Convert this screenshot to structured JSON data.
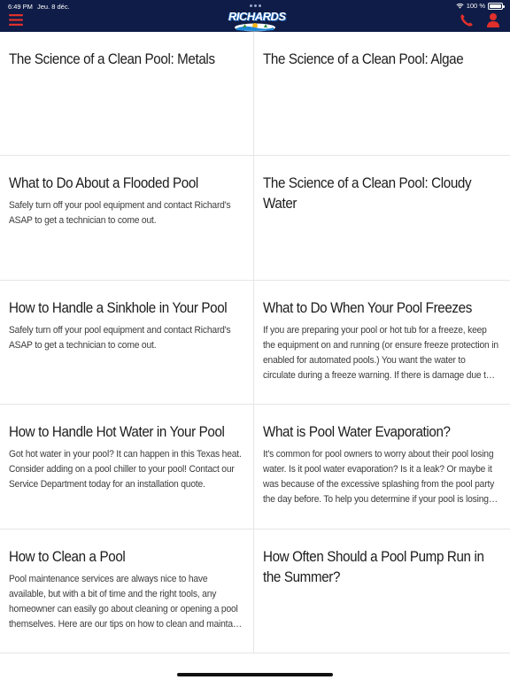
{
  "status_bar": {
    "time": "6:49 PM",
    "date": "Jeu. 8 déc.",
    "battery": "100 %"
  },
  "header": {
    "logo_text": "RICHARDS",
    "menu_icon": "hamburger-menu-icon",
    "phone_icon": "phone-icon",
    "account_icon": "user-icon",
    "accent_color": "#e0302c",
    "bar_color": "#0f1c47"
  },
  "articles": [
    {
      "title": "The Science of a Clean Pool: Metals",
      "description": ""
    },
    {
      "title": "The Science of a Clean Pool: Algae",
      "description": ""
    },
    {
      "title": "What to Do About a Flooded Pool",
      "description": "Safely turn off your pool equipment and contact Richard's ASAP to get a technician to come out."
    },
    {
      "title": "The Science of a Clean Pool: Cloudy Water",
      "description": ""
    },
    {
      "title": "How to Handle a Sinkhole in Your Pool",
      "description": "Safely turn off your pool equipment and contact Richard's ASAP to get a technician to come out."
    },
    {
      "title": "What to Do When Your Pool Freezes",
      "description": "If you are preparing your pool or hot tub for a freeze, keep the equipment on and running (or ensure freeze protection in enabled for automated pools.) You want the water to circulate during a freeze warning. If there is damage due to a freeze, contact us."
    },
    {
      "title": "How to Handle Hot Water in Your Pool",
      "description": "Got hot water in your pool? It can happen in this Texas heat. Consider adding on a pool chiller to your pool! Contact our Service Department today for an installation quote."
    },
    {
      "title": "What is Pool Water Evaporation?",
      "description": "It's common for pool owners to worry about their pool losing water. Is it pool water evaporation? Is it a leak? Or maybe it was because of the excessive splashing from the pool party the day before. To help you determine if your pool is losing water."
    },
    {
      "title": " How to Clean a Pool",
      "description": "Pool maintenance services are always nice to have available, but with a bit of time and the right tools, any homeowner can easily go about cleaning or opening a pool themselves. Here are our tips on how to clean and maintain a  pool:"
    },
    {
      "title": "How Often Should a Pool Pump Run in the Summer?",
      "description": ""
    }
  ]
}
